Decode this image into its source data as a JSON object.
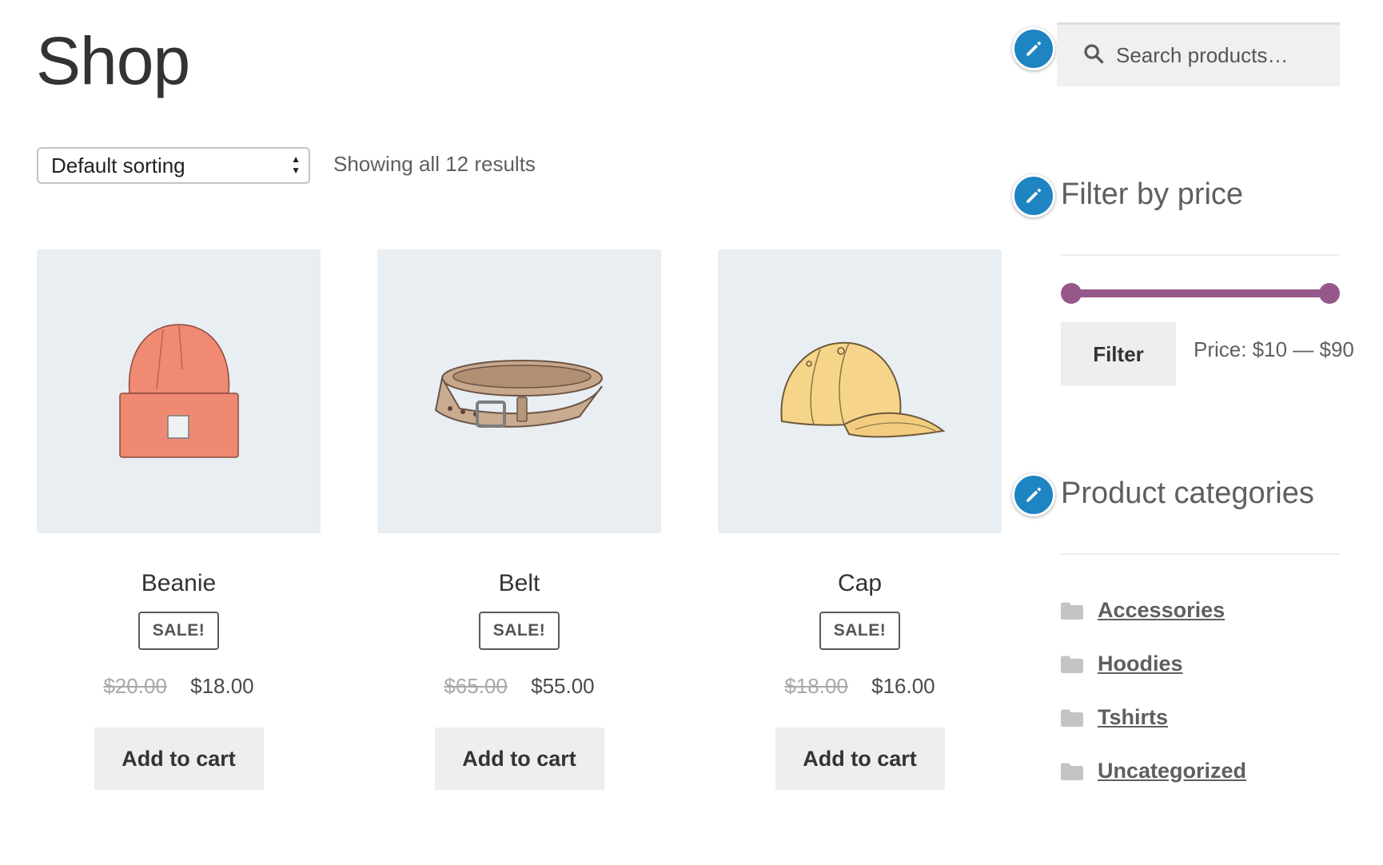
{
  "page": {
    "title": "Shop"
  },
  "toolbar": {
    "sorting_selected": "Default sorting",
    "result_count": "Showing all 12 results"
  },
  "products": [
    {
      "name": "Beanie",
      "badge": "SALE!",
      "old_price": "$20.00",
      "price": "$18.00",
      "button": "Add to cart",
      "image": "beanie"
    },
    {
      "name": "Belt",
      "badge": "SALE!",
      "old_price": "$65.00",
      "price": "$55.00",
      "button": "Add to cart",
      "image": "belt"
    },
    {
      "name": "Cap",
      "badge": "SALE!",
      "old_price": "$18.00",
      "price": "$16.00",
      "button": "Add to cart",
      "image": "cap"
    }
  ],
  "sidebar": {
    "search": {
      "placeholder": "Search products…",
      "icon": "search-icon"
    },
    "price_filter": {
      "title": "Filter by price",
      "button": "Filter",
      "range_text": "Price: $10 — $90",
      "min_fraction": 0,
      "max_fraction": 1,
      "color": "#96588a"
    },
    "categories": {
      "title": "Product categories",
      "items": [
        "Accessories",
        "Hoodies",
        "Tshirts",
        "Uncategorized"
      ],
      "icon": "folder-icon"
    },
    "edit_icon": "pencil-icon"
  },
  "colors": {
    "accent": "#96588a",
    "edit_badge": "#1e85c2",
    "product_bg": "#e9eef3",
    "button_bg": "#eeeeee"
  }
}
